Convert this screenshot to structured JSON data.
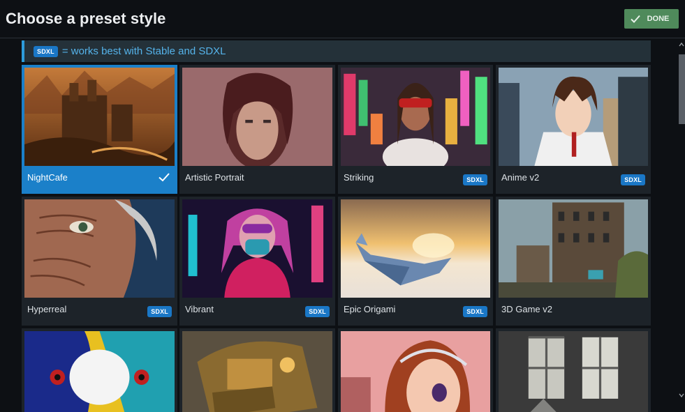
{
  "header": {
    "title": "Choose a preset style",
    "done_label": "DONE"
  },
  "notice": {
    "badge": "SDXL",
    "text": "= works best with Stable and SDXL"
  },
  "styles": [
    {
      "label": "NightCafe",
      "badge": "",
      "selected": true
    },
    {
      "label": "Artistic Portrait",
      "badge": "",
      "selected": false
    },
    {
      "label": "Striking",
      "badge": "SDXL",
      "selected": false
    },
    {
      "label": "Anime v2",
      "badge": "SDXL",
      "selected": false
    },
    {
      "label": "Hyperreal",
      "badge": "SDXL",
      "selected": false
    },
    {
      "label": "Vibrant",
      "badge": "SDXL",
      "selected": false
    },
    {
      "label": "Epic Origami",
      "badge": "SDXL",
      "selected": false
    },
    {
      "label": "3D Game v2",
      "badge": "",
      "selected": false
    },
    {
      "label": "",
      "badge": "",
      "selected": false
    },
    {
      "label": "",
      "badge": "",
      "selected": false
    },
    {
      "label": "",
      "badge": "",
      "selected": false
    },
    {
      "label": "",
      "badge": "",
      "selected": false
    }
  ],
  "colors": {
    "accent": "#1b80c9",
    "done": "#4f8a5b",
    "badge": "#1a77c6",
    "card": "#1d2329",
    "notice_bg": "#243139"
  }
}
